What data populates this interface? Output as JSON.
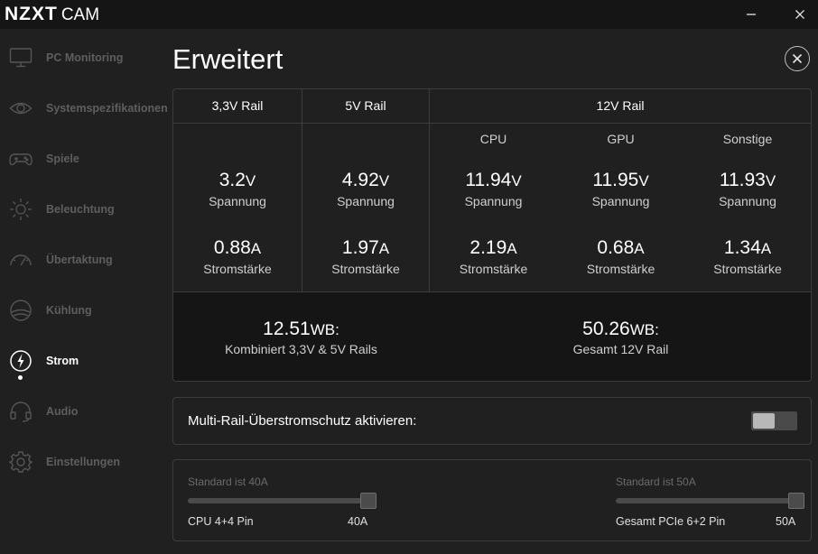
{
  "app": {
    "brand": "NZXT",
    "brand_sub": "CAM"
  },
  "window": {
    "minimize_icon": "minimize-icon",
    "close_icon": "close-icon"
  },
  "sidebar": {
    "items": [
      {
        "label": "PC Monitoring",
        "icon": "monitor-icon",
        "active": false
      },
      {
        "label": "Systemspezifikationen",
        "icon": "eye-icon",
        "active": false
      },
      {
        "label": "Spiele",
        "icon": "gamepad-icon",
        "active": false
      },
      {
        "label": "Beleuchtung",
        "icon": "sun-icon",
        "active": false
      },
      {
        "label": "Übertaktung",
        "icon": "gauge-icon",
        "active": false
      },
      {
        "label": "Kühlung",
        "icon": "fan-icon",
        "active": false
      },
      {
        "label": "Strom",
        "icon": "lightning-icon",
        "active": true
      },
      {
        "label": "Audio",
        "icon": "headset-icon",
        "active": false
      },
      {
        "label": "Einstellungen",
        "icon": "gear-icon",
        "active": false
      }
    ]
  },
  "page": {
    "title": "Erweitert"
  },
  "rails": {
    "headers": {
      "rail33": "3,3V Rail",
      "rail5": "5V Rail",
      "rail12": "12V Rail"
    },
    "sub_headers": {
      "cpu": "CPU",
      "gpu": "GPU",
      "other": "Sonstige"
    },
    "voltage_label": "Spannung",
    "current_label": "Stromstärke",
    "volt_unit": "V",
    "amp_unit": "A",
    "values": {
      "rail33": {
        "voltage": "3.2",
        "current": "0.88"
      },
      "rail5": {
        "voltage": "4.92",
        "current": "1.97"
      },
      "cpu": {
        "voltage": "11.94",
        "current": "2.19"
      },
      "gpu": {
        "voltage": "11.95",
        "current": "0.68"
      },
      "other": {
        "voltage": "11.93",
        "current": "1.34"
      }
    }
  },
  "summary": {
    "combined": {
      "value": "12.51",
      "unit": "WB:",
      "label": "Kombiniert 3,3V & 5V Rails"
    },
    "total12": {
      "value": "50.26",
      "unit": "WB:",
      "label": "Gesamt 12V Rail"
    }
  },
  "protection": {
    "label": "Multi-Rail-Überstromschutz aktivieren:",
    "enabled": false
  },
  "sliders": {
    "cpu": {
      "hint": "Standard ist 40A",
      "label": "CPU 4+4 Pin",
      "value": "40A",
      "fraction": 1.0
    },
    "pcie": {
      "hint": "Standard ist 50A",
      "label": "Gesamt PCIe 6+2 Pin",
      "value": "50A",
      "fraction": 1.0
    }
  }
}
